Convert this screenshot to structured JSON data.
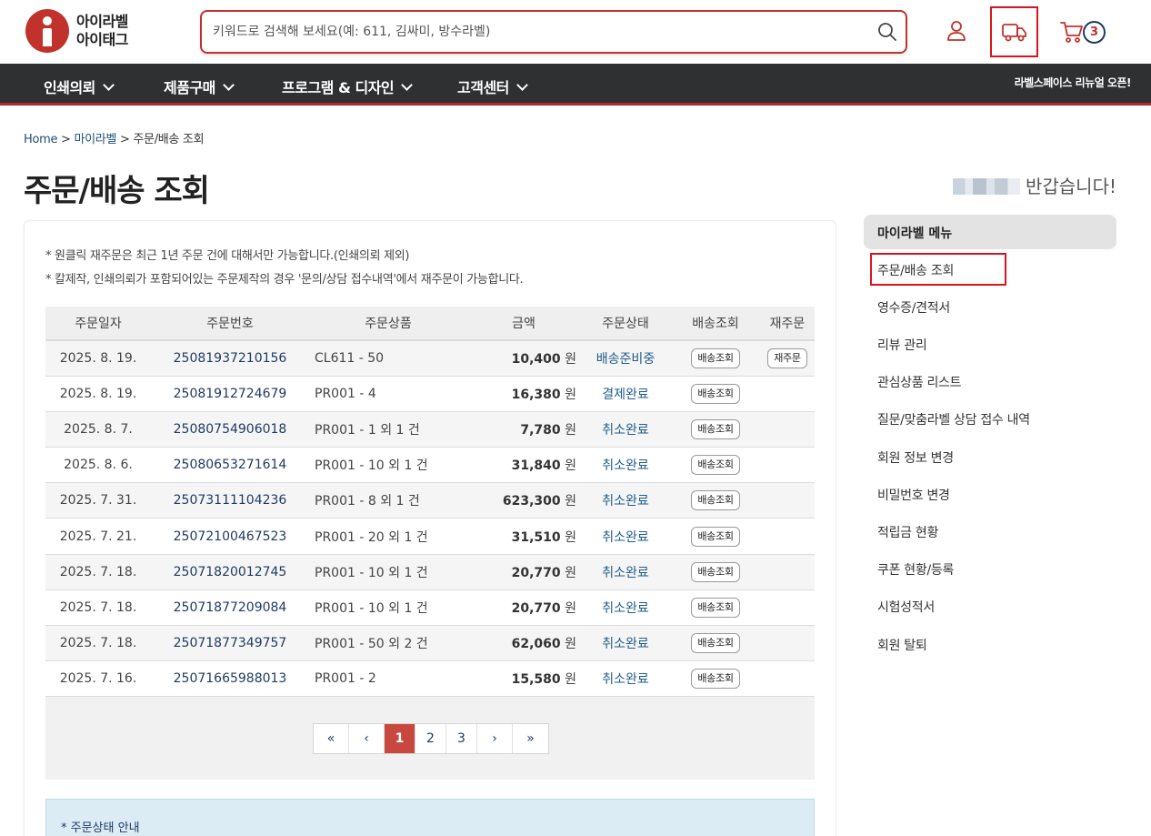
{
  "header": {
    "logo_line1": "아이라벨",
    "logo_line2": "아이태그",
    "search_placeholder": "키워드로 검색해 보세요(예: 611, 김싸미, 방수라벨)",
    "cart_count": "3"
  },
  "nav": {
    "items": [
      "인쇄의뢰",
      "제품구매",
      "프로그램 & 디자인",
      "고객센터"
    ],
    "notice": "라벨스페이스 리뉴얼 오픈!"
  },
  "breadcrumb": {
    "home": "Home",
    "sep1": " > ",
    "mylabel": "마이라벨",
    "sep2": " > ",
    "current": "주문/배송 조회"
  },
  "page": {
    "title": "주문/배송 조회",
    "greeting": "반갑습니다!"
  },
  "notes": [
    "* 원클릭 재주문은 최근 1년 주문 건에 대해서만 가능합니다.(인쇄의뢰 제외)",
    "* 칼제작, 인쇄의뢰가 포함되어있는 주문제작의 경우 '문의/상담 접수내역'에서 재주문이 가능합니다."
  ],
  "table": {
    "headers": [
      "주문일자",
      "주문번호",
      "주문상품",
      "금액",
      "주문상태",
      "배송조회",
      "재주문"
    ],
    "ship_label": "배송조회",
    "reorder_label": "재주문",
    "rows": [
      {
        "date": "2025. 8. 19.",
        "num": "25081937210156",
        "prod": "CL611 - 50",
        "amt": "10,400",
        "unit": " 원",
        "status": "배송준비중",
        "reorder": true
      },
      {
        "date": "2025. 8. 19.",
        "num": "25081912724679",
        "prod": "PR001 - 4",
        "amt": "16,380",
        "unit": " 원",
        "status": "결제완료",
        "reorder": false
      },
      {
        "date": "2025. 8. 7.",
        "num": "25080754906018",
        "prod": "PR001 - 1 외 1 건",
        "amt": "7,780",
        "unit": " 원",
        "status": "취소완료",
        "reorder": false
      },
      {
        "date": "2025. 8. 6.",
        "num": "25080653271614",
        "prod": "PR001 - 10 외 1 건",
        "amt": "31,840",
        "unit": " 원",
        "status": "취소완료",
        "reorder": false
      },
      {
        "date": "2025. 7. 31.",
        "num": "25073111104236",
        "prod": "PR001 - 8 외 1 건",
        "amt": "623,300",
        "unit": " 원",
        "status": "취소완료",
        "reorder": false
      },
      {
        "date": "2025. 7. 21.",
        "num": "25072100467523",
        "prod": "PR001 - 20 외 1 건",
        "amt": "31,510",
        "unit": " 원",
        "status": "취소완료",
        "reorder": false
      },
      {
        "date": "2025. 7. 18.",
        "num": "25071820012745",
        "prod": "PR001 - 10 외 1 건",
        "amt": "20,770",
        "unit": " 원",
        "status": "취소완료",
        "reorder": false
      },
      {
        "date": "2025. 7. 18.",
        "num": "25071877209084",
        "prod": "PR001 - 10 외 1 건",
        "amt": "20,770",
        "unit": " 원",
        "status": "취소완료",
        "reorder": false
      },
      {
        "date": "2025. 7. 18.",
        "num": "25071877349757",
        "prod": "PR001 - 50 외 2 건",
        "amt": "62,060",
        "unit": " 원",
        "status": "취소완료",
        "reorder": false
      },
      {
        "date": "2025. 7. 16.",
        "num": "25071665988013",
        "prod": "PR001 - 2",
        "amt": "15,580",
        "unit": " 원",
        "status": "취소완료",
        "reorder": false
      }
    ]
  },
  "pager": {
    "first": "«",
    "prev": "‹",
    "pages": [
      "1",
      "2",
      "3"
    ],
    "active": "1",
    "next": "›",
    "last": "»"
  },
  "guide": {
    "label": "* 주문상태 안내"
  },
  "sidebar": {
    "title": "마이라벨 메뉴",
    "items": [
      "주문/배송 조회",
      "영수증/견적서",
      "리뷰 관리",
      "관심상품 리스트",
      "질문/맞춤라벨 상담 접수 내역",
      "회원 정보 변경",
      "비밀번호 변경",
      "적립금 현황",
      "쿠폰 현황/등록",
      "시험성적서",
      "회원 탈퇴"
    ]
  },
  "colors": {
    "brand_red": "#c0322b",
    "nav_bg": "#2e3032",
    "link_blue": "#1f3b63",
    "highlight": "#d9141c"
  }
}
